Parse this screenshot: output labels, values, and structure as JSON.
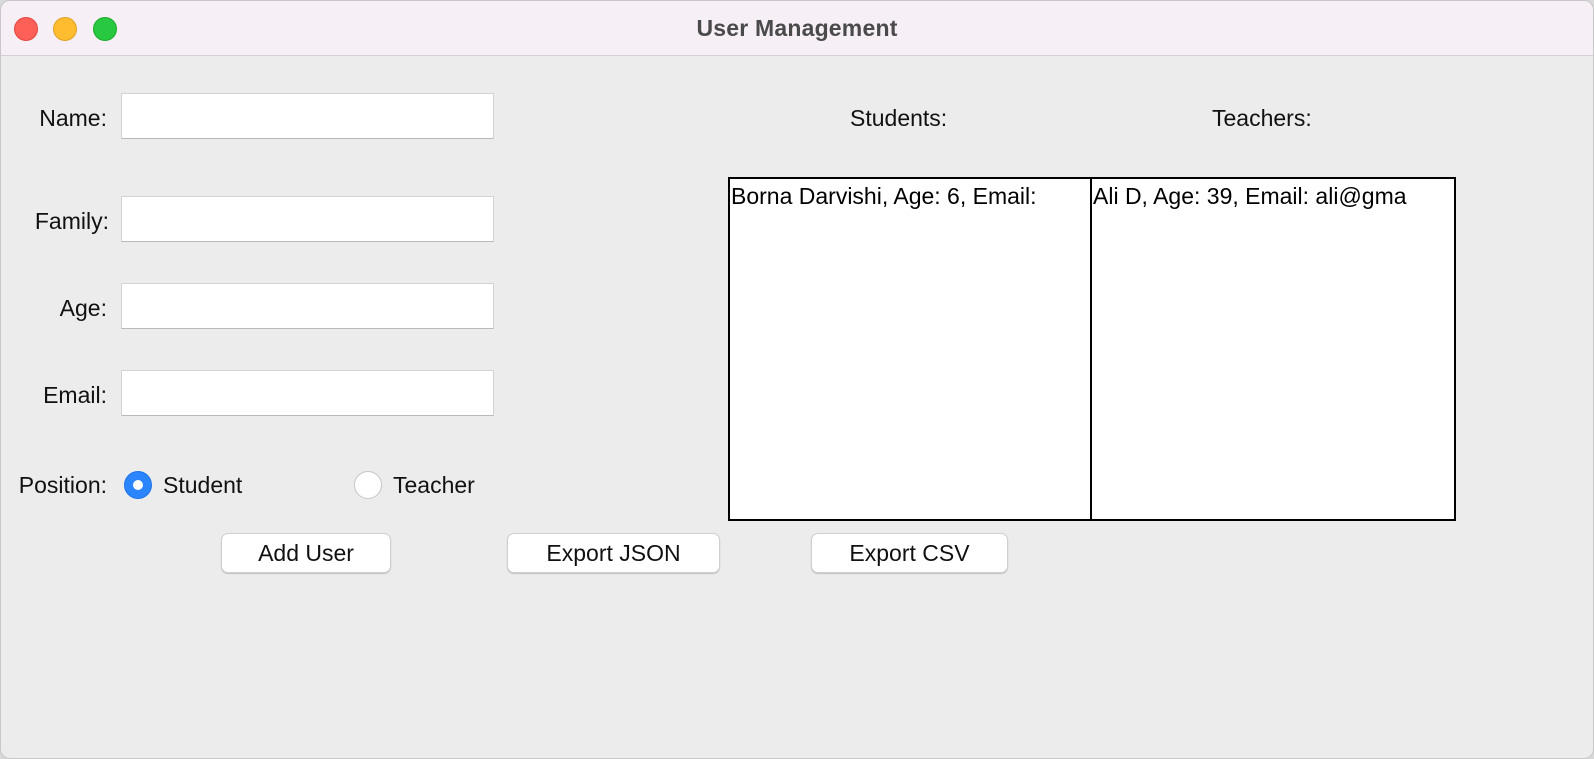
{
  "window": {
    "title": "User Management"
  },
  "form": {
    "name_label": "Name:",
    "name_value": "",
    "family_label": "Family:",
    "family_value": "",
    "age_label": "Age:",
    "age_value": "",
    "email_label": "Email:",
    "email_value": "",
    "position_label": "Position:",
    "positions": [
      {
        "label": "Student",
        "selected": true
      },
      {
        "label": "Teacher",
        "selected": false
      }
    ]
  },
  "buttons": {
    "add_user": "Add User",
    "export_json": "Export JSON",
    "export_csv": "Export CSV"
  },
  "lists": {
    "students_label": "Students:",
    "students": [
      "Borna Darvishi, Age: 6, Email:"
    ],
    "teachers_label": "Teachers:",
    "teachers": [
      "Ali D, Age: 39, Email: ali@gma"
    ]
  },
  "colors": {
    "window_bg": "#ececec",
    "titlebar_bg": "#f6eff6",
    "radio_accent": "#2b85ff",
    "close": "#fe5f57",
    "minimize": "#febc2e",
    "maximize": "#28c840"
  }
}
